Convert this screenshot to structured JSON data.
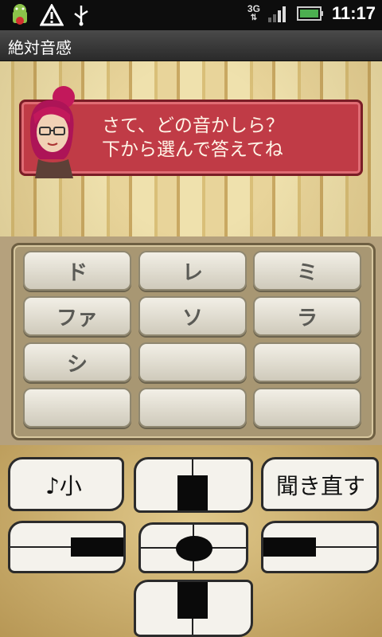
{
  "statusbar": {
    "time": "11:17",
    "network": "3G",
    "icons": [
      "android-debug-icon",
      "warning-icon",
      "usb-icon",
      "signal-icon",
      "battery-icon"
    ]
  },
  "app": {
    "title": "絶対音感"
  },
  "message": {
    "line1": "さて、どの音かしら？",
    "line2": "下から選んで答えてね"
  },
  "notes": [
    "ド",
    "レ",
    "ミ",
    "ファ",
    "ソ",
    "ラ",
    "シ",
    "",
    "",
    "",
    "",
    ""
  ],
  "controls": {
    "volume_label": "♪小",
    "replay_label": "聞き直す"
  },
  "colors": {
    "bubble": "#c03b46",
    "wallpaper": "#efe1ad",
    "board": "#b5a17d",
    "controls_bg": "#d8bd78"
  }
}
